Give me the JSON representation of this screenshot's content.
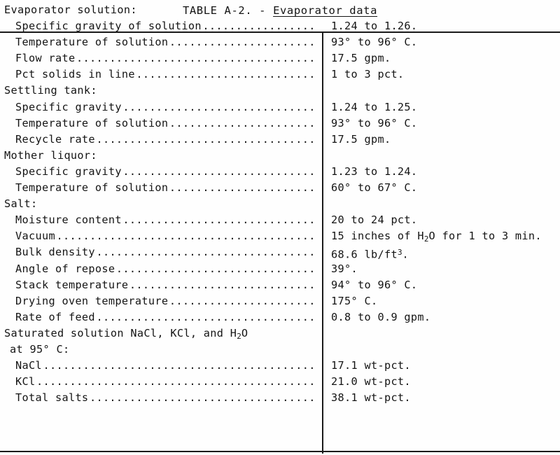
{
  "title": {
    "prefix": "TABLE A-2. - ",
    "subject": "Evaporator data"
  },
  "table": {
    "rows": [
      {
        "kind": "group",
        "label": "Evaporator solution:",
        "value": ""
      },
      {
        "kind": "item",
        "label": "Specific gravity of solution",
        "value": "1.24 to 1.26."
      },
      {
        "kind": "item",
        "label": "Temperature of solution",
        "value": "93° to 96° C."
      },
      {
        "kind": "item",
        "label": "Flow rate",
        "value": "17.5 gpm."
      },
      {
        "kind": "item",
        "label": "Pct solids in line",
        "value": "1 to 3 pct."
      },
      {
        "kind": "group",
        "label": "Settling tank:",
        "value": ""
      },
      {
        "kind": "item",
        "label": "Specific gravity",
        "value": "1.24 to 1.25."
      },
      {
        "kind": "item",
        "label": "Temperature of solution",
        "value": "93° to 96° C."
      },
      {
        "kind": "item",
        "label": "Recycle rate",
        "value": "17.5 gpm."
      },
      {
        "kind": "group",
        "label": "Mother liquor:",
        "value": ""
      },
      {
        "kind": "item",
        "label": "Specific gravity",
        "value": "1.23 to 1.24."
      },
      {
        "kind": "item",
        "label": "Temperature of solution",
        "value": "60° to 67° C."
      },
      {
        "kind": "group",
        "label": "Salt:",
        "value": ""
      },
      {
        "kind": "item",
        "label": "Moisture content",
        "value": "20 to 24 pct."
      },
      {
        "kind": "item",
        "label": "Vacuum",
        "value": "15 inches of H<sub>2</sub>O for 1 to 3 min.",
        "html": true
      },
      {
        "kind": "item",
        "label": "Bulk density",
        "value": "68.6 lb/ft<sup>3</sup>.",
        "html": true
      },
      {
        "kind": "item",
        "label": "Angle of repose",
        "value": "39°."
      },
      {
        "kind": "item",
        "label": "Stack temperature",
        "value": "94° to 96° C."
      },
      {
        "kind": "item",
        "label": "Drying oven temperature",
        "value": "175° C."
      },
      {
        "kind": "item",
        "label": "Rate of feed",
        "value": "0.8 to 0.9 gpm."
      },
      {
        "kind": "group",
        "label": "Saturated solution NaCl, KCl, and H<sub>2</sub>O",
        "value": "",
        "html": true
      },
      {
        "kind": "subgroup",
        "label": "at 95° C:",
        "value": ""
      },
      {
        "kind": "item",
        "label": "NaCl",
        "value": "17.1 wt-pct."
      },
      {
        "kind": "item",
        "label": "KCl",
        "value": "21.0 wt-pct."
      },
      {
        "kind": "item",
        "label": "Total salts",
        "value": "38.1 wt-pct."
      }
    ]
  }
}
